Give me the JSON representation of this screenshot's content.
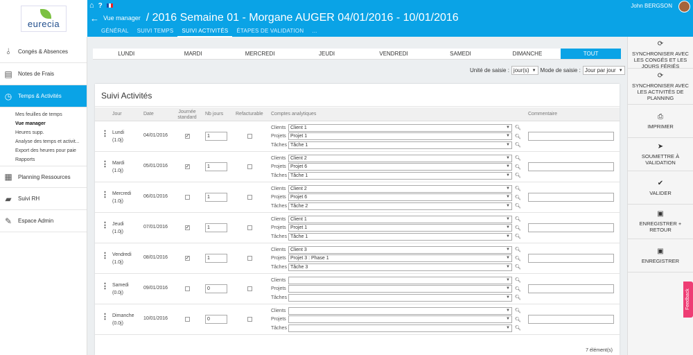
{
  "header": {
    "user_name": "John BERGSON",
    "back_label": "Vue manager",
    "title": "/ 2016 Semaine 01 - Morgane AUGER 04/01/2016 - 10/01/2016",
    "tabs": [
      "GÉNÉRAL",
      "SUIVI TEMPS",
      "SUIVI ACTIVITÉS",
      "ÉTAPES DE VALIDATION",
      "..."
    ]
  },
  "logo": {
    "text": "eurecia"
  },
  "sidebar": {
    "items": [
      {
        "label": "Congés & Absences",
        "icon": "flip-flops-icon"
      },
      {
        "label": "Notes de Frais",
        "icon": "receipt-icon"
      },
      {
        "label": "Temps & Activités",
        "icon": "clock-icon"
      },
      {
        "label": "Planning Ressources",
        "icon": "calendar-icon"
      },
      {
        "label": "Suivi RH",
        "icon": "folder-icon"
      },
      {
        "label": "Espace Admin",
        "icon": "wrench-icon"
      }
    ],
    "sub_items": [
      "Mes feuilles de temps",
      "Vue manager",
      "Heures supp.",
      "Analyse des temps et activit...",
      "Export des heures pour paie",
      "Rapports"
    ]
  },
  "days": [
    "LUNDI",
    "MARDI",
    "MERCREDI",
    "JEUDI",
    "VENDREDI",
    "SAMEDI",
    "DIMANCHE",
    "TOUT"
  ],
  "saisie": {
    "unite_label": "Unité de saisie :",
    "unite_value": "jour(s)",
    "mode_label": "Mode de saisie :",
    "mode_value": "Jour par jour"
  },
  "card": {
    "title": "Suivi Activités",
    "headers": {
      "jour": "Jour",
      "date": "Date",
      "journee": "Journée standard",
      "nb": "Nb jours",
      "refact": "Refacturable",
      "comptes": "Comptes analytiques",
      "commentaire": "Commentaire"
    },
    "account_labels": {
      "clients": "Clients",
      "projets": "Projets",
      "taches": "Tâches"
    },
    "count": "7 élément(s)"
  },
  "rows": [
    {
      "day": "Lundi",
      "sub": "(1.0j)",
      "date": "04/01/2016",
      "standard": true,
      "nb": "1",
      "client": "Client 1",
      "projet": "Projet 1",
      "tache": "Tâche 1"
    },
    {
      "day": "Mardi",
      "sub": "(1.0j)",
      "date": "05/01/2016",
      "standard": true,
      "nb": "1",
      "client": "Client 2",
      "projet": "Projet 6",
      "tache": "Tâche 1"
    },
    {
      "day": "Mercredi",
      "sub": "(1.0j)",
      "date": "06/01/2016",
      "standard": false,
      "nb": "1",
      "client": "Client 2",
      "projet": "Projet 6",
      "tache": "Tâche 2"
    },
    {
      "day": "Jeudi",
      "sub": "(1.0j)",
      "date": "07/01/2016",
      "standard": true,
      "nb": "1",
      "client": "Client 1",
      "projet": "Projet 1",
      "tache": "Tâche 1"
    },
    {
      "day": "Vendredi",
      "sub": "(1.0j)",
      "date": "08/01/2016",
      "standard": true,
      "nb": "1",
      "client": "Client 3",
      "projet": "Projet 3 : Phase 1",
      "tache": "Tâche 3"
    },
    {
      "day": "Samedi",
      "sub": "(0.0j)",
      "date": "09/01/2016",
      "standard": false,
      "nb": "0",
      "client": "",
      "projet": "",
      "tache": ""
    },
    {
      "day": "Dimanche",
      "sub": "(0.0j)",
      "date": "10/01/2016",
      "standard": false,
      "nb": "0",
      "client": "",
      "projet": "",
      "tache": ""
    }
  ],
  "actions": [
    {
      "label": "SYNCHRONISER AVEC LES CONGÉS ET LES JOURS FÉRIÉS",
      "icon": "refresh-icon"
    },
    {
      "label": "SYNCHRONISER AVEC LES ACTIVITÉS DE PLANNING",
      "icon": "refresh-icon"
    },
    {
      "label": "IMPRIMER",
      "icon": "print-icon"
    },
    {
      "label": "SOUMETTRE À VALIDATION",
      "icon": "send-icon"
    },
    {
      "label": "VALIDER",
      "icon": "check-icon"
    },
    {
      "label": "ENREGISTRER + RETOUR",
      "icon": "save-icon"
    },
    {
      "label": "ENREGISTRER",
      "icon": "save-icon"
    }
  ],
  "feedback": "Feedback"
}
